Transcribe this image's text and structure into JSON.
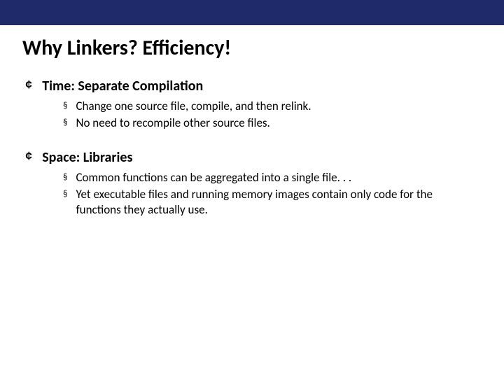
{
  "title": "Why Linkers? Efficiency!",
  "items": [
    {
      "heading": "Time: Separate Compilation",
      "subs": [
        "Change one source file, compile, and then relink.",
        "No need to recompile other source files."
      ]
    },
    {
      "heading": "Space: Libraries",
      "subs": [
        "Common functions can be aggregated into a single file. . .",
        "Yet executable files and running memory images contain only code for the functions they actually use."
      ]
    }
  ]
}
